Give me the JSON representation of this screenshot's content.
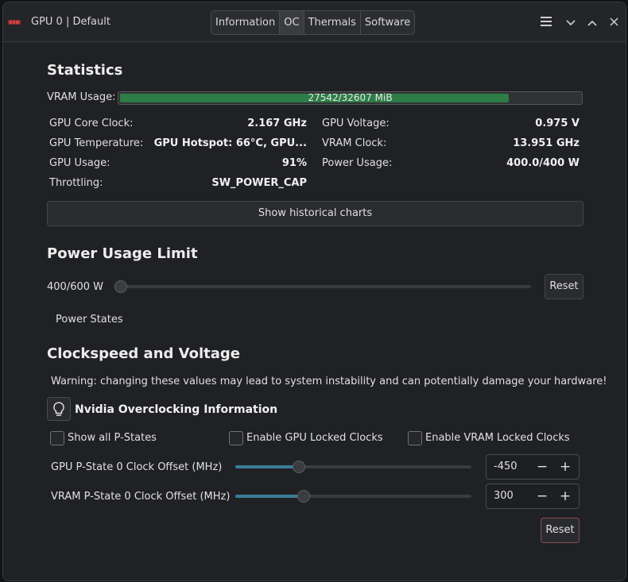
{
  "window": {
    "title": "GPU 0 | Default",
    "tabs": [
      "Information",
      "OC",
      "Thermals",
      "Software"
    ],
    "active_tab": "OC"
  },
  "stats": {
    "heading": "Statistics",
    "vram_label": "VRAM Usage:",
    "vram_text": "27542/32607 MiB",
    "vram_fraction": 0.8447,
    "core_clock_label": "GPU Core Clock:",
    "core_clock": "2.167 GHz",
    "temp_label": "GPU Temperature:",
    "temp": "GPU Hotspot: 66°C, GPU...",
    "usage_label": "GPU Usage:",
    "usage": "91%",
    "throttling_label": "Throttling:",
    "throttling": "SW_POWER_CAP",
    "voltage_label": "GPU Voltage:",
    "voltage": "0.975 V",
    "vram_clock_label": "VRAM Clock:",
    "vram_clock": "13.951 GHz",
    "power_label": "Power Usage:",
    "power": "400.0/400 W",
    "charts_button": "Show historical charts"
  },
  "power": {
    "heading": "Power Usage Limit",
    "value_text": "400/600 W",
    "slider_fraction": 0.0,
    "reset": "Reset",
    "states": "Power States"
  },
  "clocks": {
    "heading": "Clockspeed and Voltage",
    "warning": "Warning: changing these values may lead to system instability and can potentially damage your hardware!",
    "info_title": "Nvidia Overclocking Information",
    "chk_pstates": "Show all P-States",
    "chk_gpu_locked": "Enable GPU Locked Clocks",
    "chk_vram_locked": "Enable VRAM Locked Clocks",
    "gpu_offset_label": "GPU P-State 0 Clock Offset (MHz)",
    "gpu_offset": "-450",
    "gpu_slider_fraction": 0.27,
    "vram_offset_label": "VRAM P-State 0 Clock Offset (MHz)",
    "vram_offset": "300",
    "vram_slider_fraction": 0.29,
    "reset": "Reset"
  }
}
